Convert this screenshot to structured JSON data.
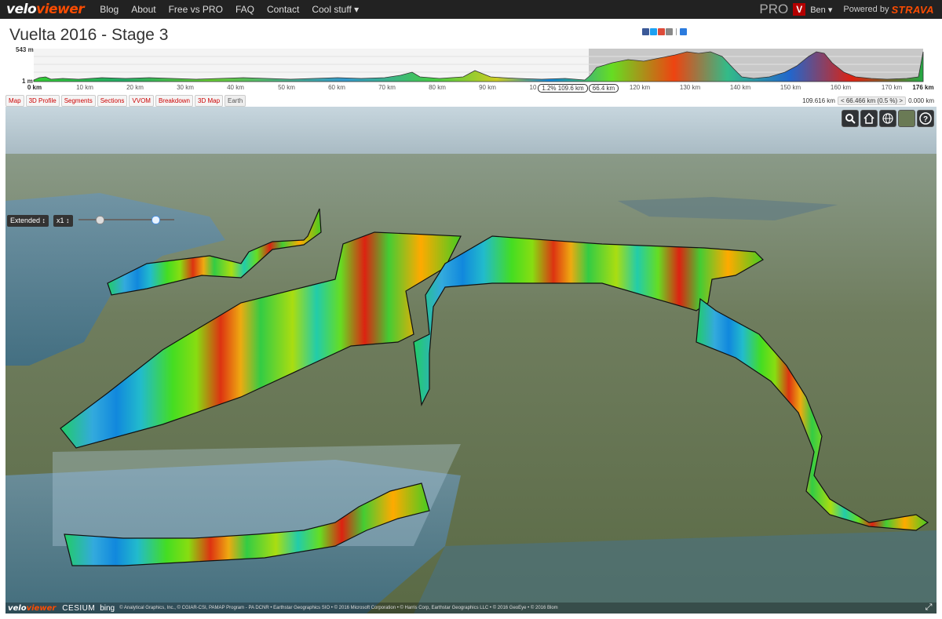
{
  "nav": {
    "logo_part1": "velo",
    "logo_part2": "viewer",
    "links": [
      "Blog",
      "About",
      "Free vs PRO",
      "FAQ",
      "Contact",
      "Cool stuff ▾"
    ],
    "pro_label": "PRO",
    "avatar_letter": "V",
    "user": "Ben ▾",
    "powered_by": "Powered by",
    "strava": "STRAVA"
  },
  "page": {
    "title": "Vuelta 2016 - Stage 3"
  },
  "profile": {
    "ymax": "543 m",
    "ymin": "1 m",
    "ticks": [
      {
        "label": "0 km",
        "bold": true
      },
      {
        "label": "10 km"
      },
      {
        "label": "20 km"
      },
      {
        "label": "30 km"
      },
      {
        "label": "40 km"
      },
      {
        "label": "50 km"
      },
      {
        "label": "60 km"
      },
      {
        "label": "70 km"
      },
      {
        "label": "80 km"
      },
      {
        "label": "90 km"
      },
      {
        "label": "10"
      },
      {
        "label": "120 km"
      },
      {
        "label": "130 km"
      },
      {
        "label": "140 km"
      },
      {
        "label": "150 km"
      },
      {
        "label": "160 km"
      },
      {
        "label": "170 km"
      },
      {
        "label": "176 km",
        "bold": true
      }
    ],
    "selection_start": "1.2% 109.6 km",
    "selection_end": "66.4 km"
  },
  "tabs": [
    "Map",
    "3D Profile",
    "Segments",
    "Sections",
    "VVOM",
    "Breakdown",
    "3D Map",
    "Earth"
  ],
  "active_tab": "Earth",
  "distance": {
    "left": "109.616 km",
    "middle": "< 66.466 km (0.5 %) >",
    "right": "0.000 km"
  },
  "controls": {
    "mode": "Extended ↕",
    "speed": "x1 ↕"
  },
  "map_buttons": [
    "search-icon",
    "home-icon",
    "globe-icon",
    "layers-icon",
    "help-icon"
  ],
  "attribution": {
    "logo_part1": "velo",
    "logo_part2": "viewer",
    "cesium": "CESIUM",
    "bing": "bing",
    "credits": "© Analytical Graphics, Inc., © CGIAR-CSI, PAMAP Program - PA DCNR • Earthstar Geographics SIO • © 2016 Microsoft Corporation • © Harris Corp, Earthstar Geographics LLC • © 2016 GeoEye • © 2016 Blom"
  },
  "colors": {
    "accent": "#fc4c02",
    "tab_text": "#cc0000",
    "navbar": "#222222"
  }
}
